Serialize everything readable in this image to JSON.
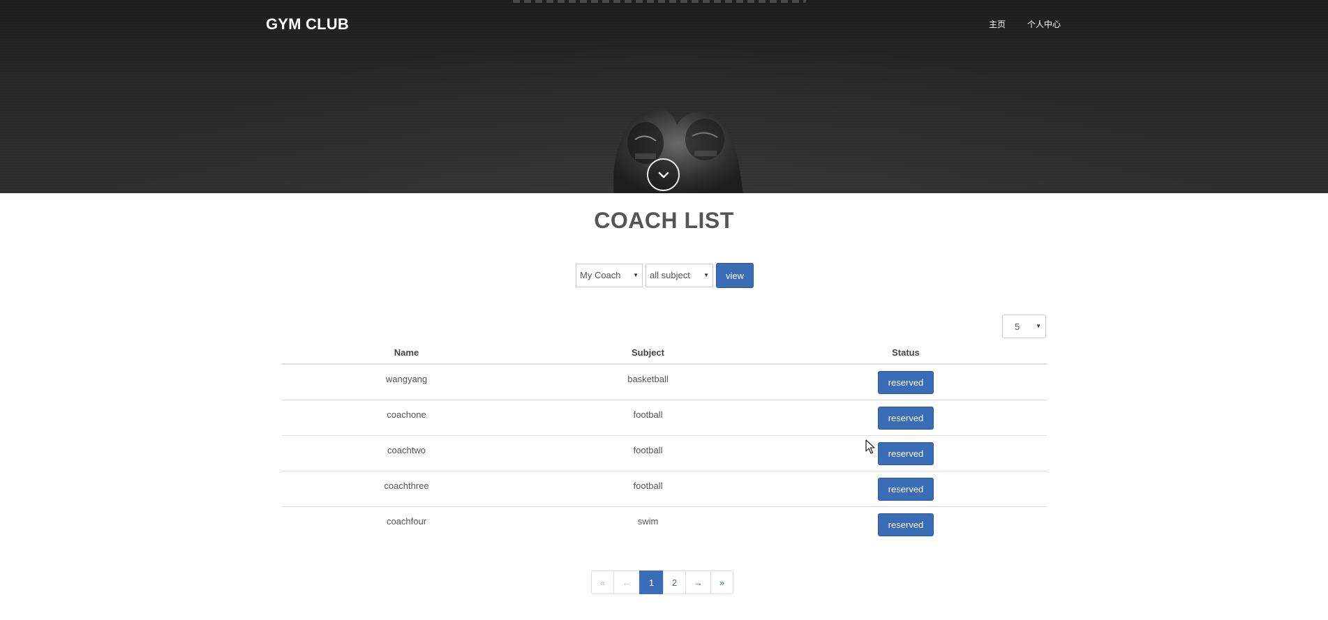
{
  "header": {
    "brand": "GYM CLUB",
    "nav": [
      {
        "label": "主页"
      },
      {
        "label": "个人中心"
      }
    ]
  },
  "main": {
    "title": "COACH LIST",
    "filters": {
      "coach_select": "My Coach",
      "subject_select": "all subject",
      "view_label": "view"
    },
    "page_size": "5",
    "table": {
      "columns": [
        "Name",
        "Subject",
        "Status"
      ],
      "rows": [
        {
          "name": "wangyang",
          "subject": "basketball",
          "status": "reserved"
        },
        {
          "name": "coachone",
          "subject": "football",
          "status": "reserved"
        },
        {
          "name": "coachtwo",
          "subject": "football",
          "status": "reserved"
        },
        {
          "name": "coachthree",
          "subject": "football",
          "status": "reserved"
        },
        {
          "name": "coachfour",
          "subject": "swim",
          "status": "reserved"
        }
      ]
    },
    "pagination": {
      "first": "«",
      "prev": "←",
      "pages": [
        "1",
        "2"
      ],
      "current": "1",
      "next": "→",
      "last": "»"
    }
  },
  "colors": {
    "accent": "#3a6db5",
    "hero_bg": "#262626"
  },
  "icons": {
    "scroll": "chevron-down-icon",
    "select": "caret-down-icon"
  }
}
